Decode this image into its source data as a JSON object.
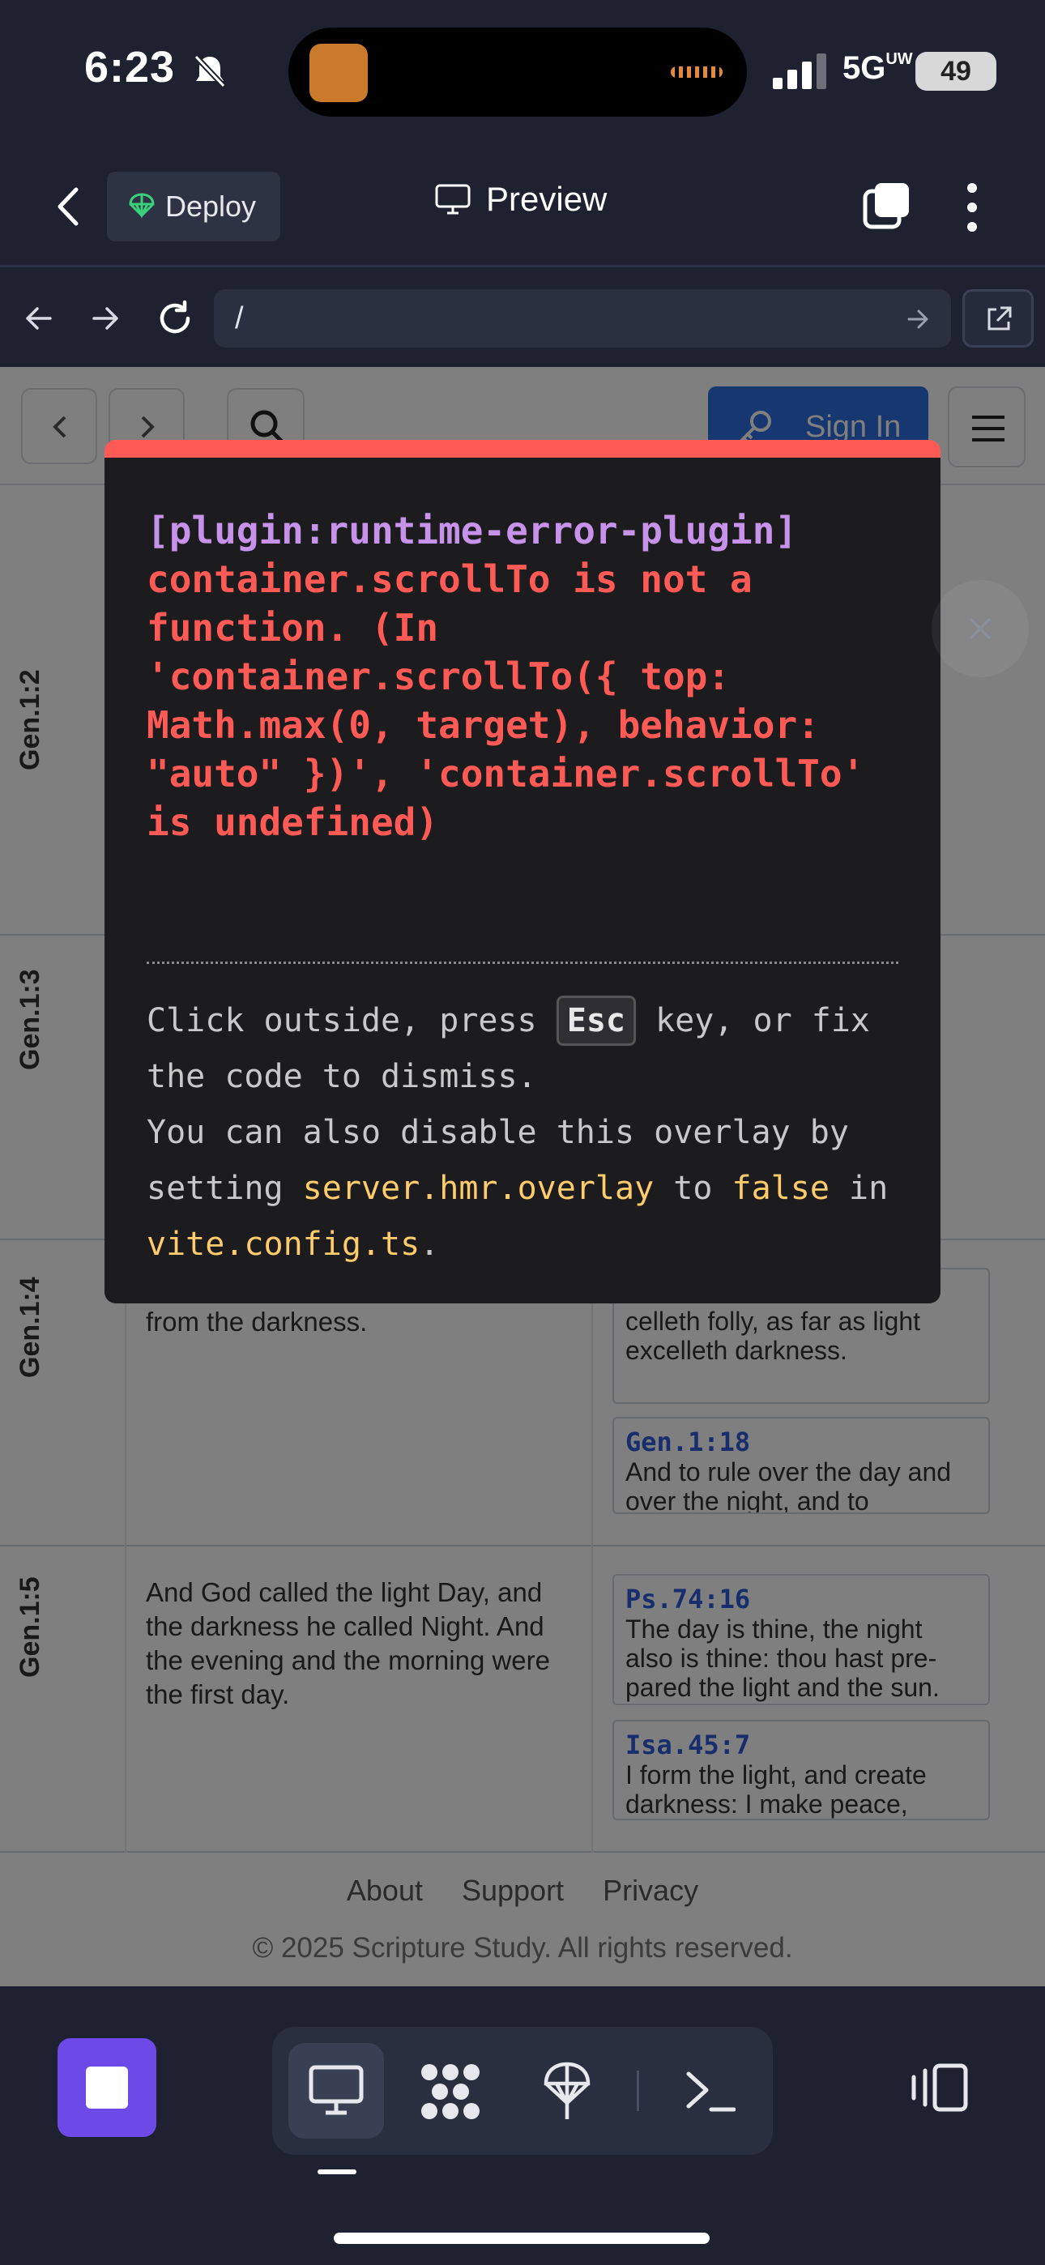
{
  "status_bar": {
    "time": "6:23",
    "network": "5G",
    "network_badge": "UW",
    "battery": "49"
  },
  "top_bar": {
    "deploy_label": "Deploy",
    "preview_label": "Preview"
  },
  "url_bar": {
    "url": "/"
  },
  "page": {
    "header": {
      "sign_in_label": "Sign In"
    },
    "rows": [
      {
        "ref": "Gen.1:2",
        "text": "",
        "cross_refs": []
      },
      {
        "ref": "Gen.1:3",
        "text": "",
        "cross_refs": []
      },
      {
        "ref": "Gen.1:4",
        "text": "good: and God divided the light from the darkness.",
        "cross_refs": [
          {
            "ref": "",
            "text": "Then I saw that wisdom ex-celleth folly, as far as light excelleth darkness."
          },
          {
            "ref": "Gen.1:18",
            "text": "And to rule over the day and over the night, and to"
          }
        ]
      },
      {
        "ref": "Gen.1:5",
        "text": "And God called the light Day, and the darkness he called Night. And the evening and the morning were the first day.",
        "cross_refs": [
          {
            "ref": "Ps.74:16",
            "text": "The day is thine, the night also is thine: thou hast pre-pared the light and the sun."
          },
          {
            "ref": "Isa.45:7",
            "text": "I form the light, and create darkness: I make peace,"
          }
        ]
      }
    ],
    "footer": {
      "links": [
        "About",
        "Support",
        "Privacy"
      ],
      "copyright": "© 2025 Scripture Study. All rights reserved."
    }
  },
  "error_overlay": {
    "plugin": "[plugin:runtime-error-plugin]",
    "message": "container.scrollTo is not a function. (In 'container.scrollTo({ top: Math.max(0, target), behavior: \"auto\" })', 'container.scrollTo' is undefined)",
    "tip_1_a": "Click outside, press",
    "tip_key": "Esc",
    "tip_1_b": "key, or fix the code to dismiss.",
    "tip_2_a": "You can also disable this overlay by setting",
    "tip_code_1": "server.hmr.overlay",
    "tip_2_b": "to",
    "tip_code_2": "false",
    "tip_2_c": "in",
    "tip_code_3": "vite.config.ts",
    "tip_2_d": "."
  },
  "colors": {
    "accent": "#6d4ae8",
    "error": "#ff5a55",
    "code": "#ffcb6b",
    "link": "#2f5bd8"
  }
}
